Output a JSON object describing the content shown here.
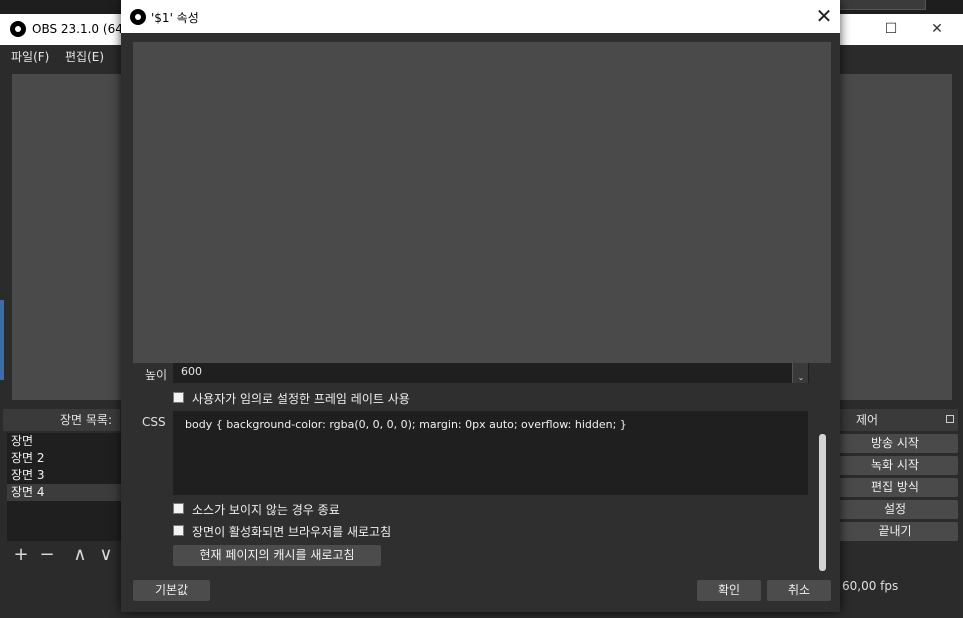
{
  "main_window": {
    "title": "OBS 23.1.0 (64-",
    "menu": [
      "파일(F)",
      "편집(E)"
    ],
    "window_controls": {
      "maximize": "☐",
      "close": "✕"
    },
    "scenes": {
      "header": "장면 목록:",
      "items": [
        "장면",
        "장면 2",
        "장면 3",
        "장면 4"
      ],
      "selected_index": 3,
      "toolbar": {
        "add": "+",
        "remove": "−",
        "up": "∧",
        "down": "∨"
      }
    },
    "controls": {
      "header": "제어",
      "buttons": [
        "방송 시작",
        "녹화 시작",
        "편집 방식",
        "설정",
        "끝내기"
      ]
    },
    "status": {
      "fps": "60,00 fps"
    }
  },
  "dialog": {
    "title": "'$1' 속성",
    "close": "✕",
    "height": {
      "label": "높이",
      "value": "600",
      "spin_down": "⌄"
    },
    "checkbox_custom_fps": "사용자가 임의로 설정한 프레임 레이트 사용",
    "css": {
      "label": "CSS",
      "value": "body { background-color: rgba(0, 0, 0, 0); margin: 0px auto; overflow: hidden; }"
    },
    "checkbox_shutdown": "소스가 보이지 않는 경우 종료",
    "checkbox_refresh": "장면이 활성화되면 브라우저를 새로고침",
    "refresh_cache_button": "현재 페이지의 캐시를 새로고침",
    "defaults_button": "기본값",
    "ok_button": "확인",
    "cancel_button": "취소"
  }
}
